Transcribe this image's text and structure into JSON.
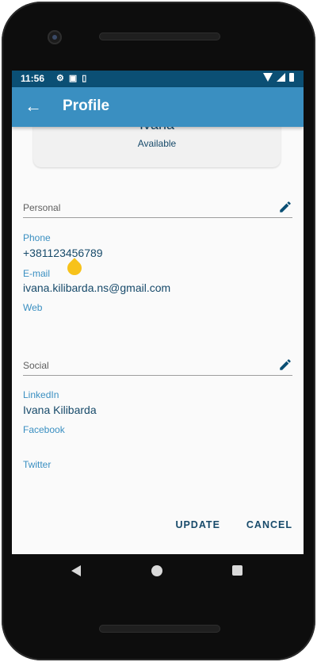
{
  "status_bar": {
    "time": "11:56",
    "left_icons": [
      "gear-icon",
      "notification-icon",
      "vibrate-icon"
    ],
    "right_icons": [
      "wifi-icon",
      "signal-icon",
      "battery-icon"
    ]
  },
  "app_bar": {
    "title": "Profile",
    "back_icon": "arrow-left-icon"
  },
  "profile_card": {
    "name": "Ivana",
    "status": "Available"
  },
  "personal": {
    "title": "Personal",
    "fields": {
      "phone_label": "Phone",
      "phone_value": "+381123456789",
      "email_label": "E-mail",
      "email_value": "ivana.kilibarda.ns@gmail.com",
      "web_label": "Web"
    }
  },
  "social": {
    "title": "Social",
    "fields": {
      "linkedin_label": "LinkedIn",
      "linkedin_value": "Ivana Kilibarda",
      "facebook_label": "Facebook",
      "twitter_label": "Twitter"
    }
  },
  "actions": {
    "update_label": "UPDATE",
    "cancel_label": "CANCEL"
  },
  "colors": {
    "status_bar": "#0b4f74",
    "app_bar": "#3a8fc1",
    "label": "#3a8fc1",
    "text": "#174a6a"
  }
}
